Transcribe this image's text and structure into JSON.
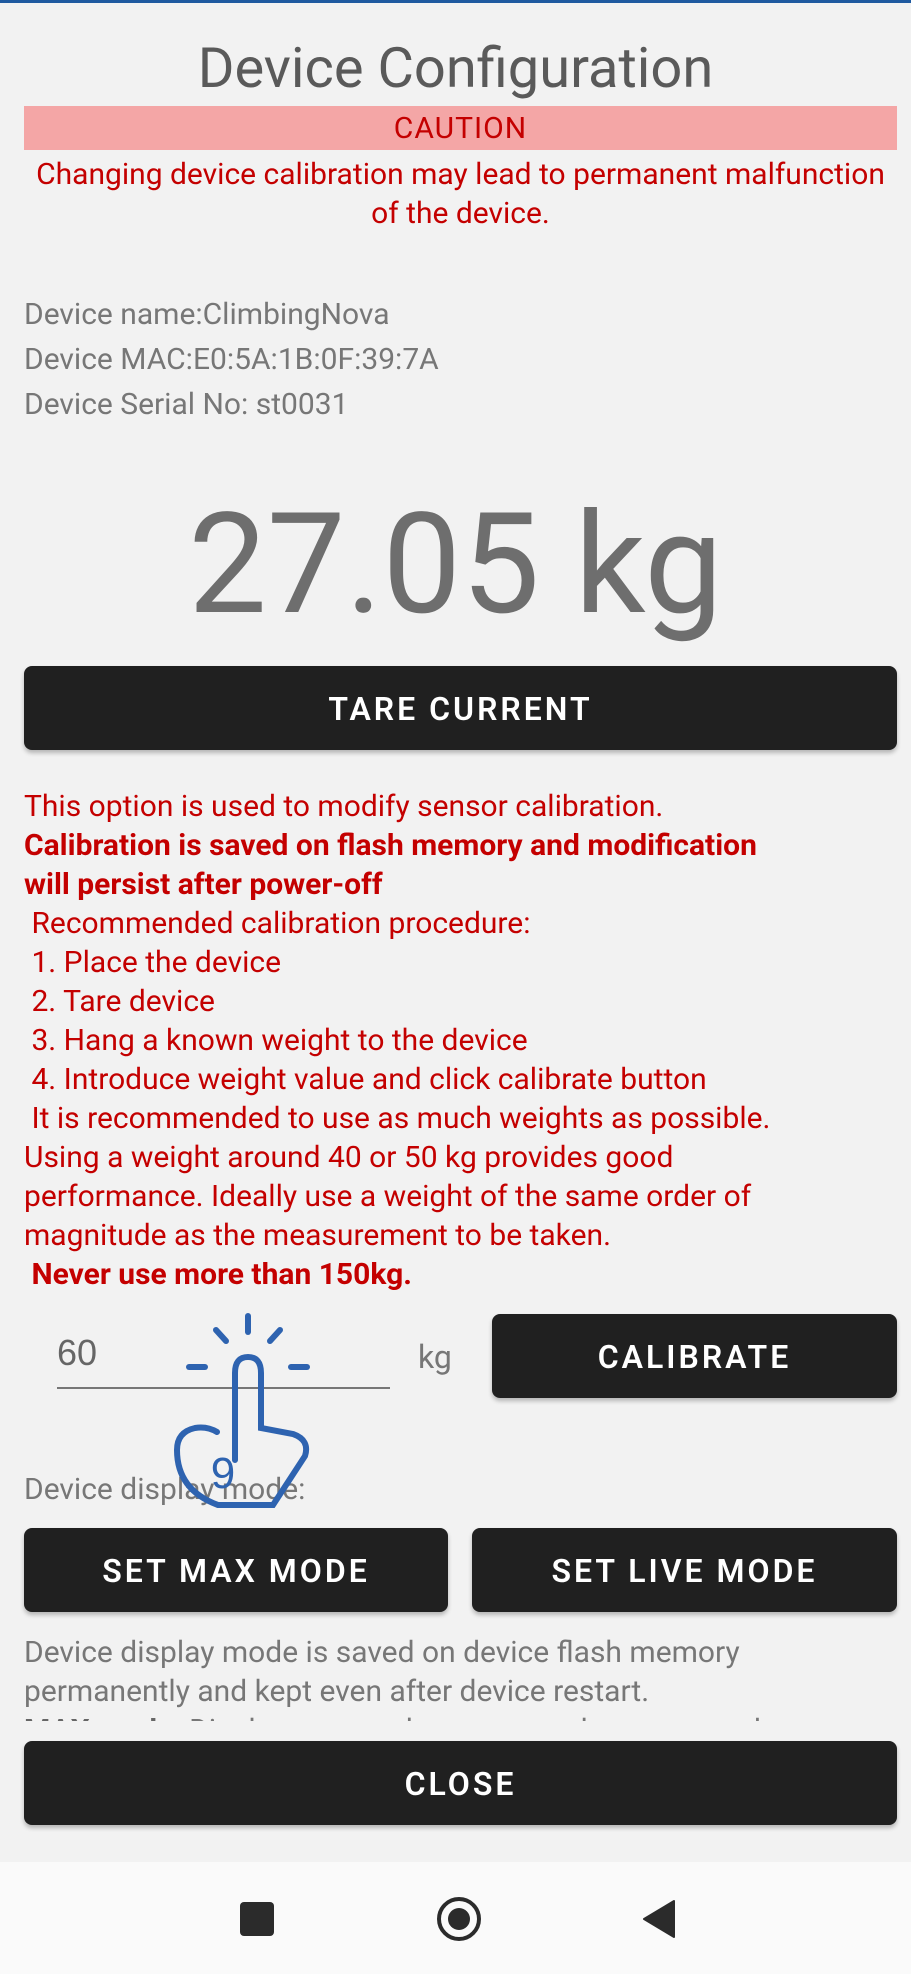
{
  "page": {
    "title": "Device Configuration",
    "caution_label": "CAUTION",
    "caution_text": "Changing device calibration may lead to permanent malfunction of the device."
  },
  "device": {
    "name_line": "Device name:ClimbingNova",
    "mac_line": "Device MAC:E0:5A:1B:0F:39:7A",
    "serial_line": "Device Serial No: st0031"
  },
  "reading": {
    "value": "27.05 kg"
  },
  "buttons": {
    "tare": "TARE CURRENT",
    "calibrate": "CALIBRATE",
    "set_max": "SET MAX MODE",
    "set_live": "SET LIVE MODE",
    "close": "CLOSE"
  },
  "calibration_help": {
    "intro": "This option is used to modify sensor calibration.",
    "persist_1": "Calibration is saved on flash memory and modification",
    "persist_2": "will persist after power-off",
    "recommended": " Recommended calibration procedure:",
    "step1": " 1. Place the device",
    "step2": " 2. Tare device",
    "step3": " 3. Hang a known weight to the device",
    "step4": " 4. Introduce weight value and click calibrate button",
    "note_1": " It is recommended to use as much weights as possible.",
    "note_2": "Using a weight around 40 or 50 kg provides good",
    "note_3": "performance. Ideally use a weight of the same order of",
    "note_4": "magnitude as the measurement to be taken.",
    "never": " Never use more than 150kg."
  },
  "calibration_input": {
    "value": "60",
    "unit": "kg"
  },
  "display_mode": {
    "label": "Device display mode:",
    "desc_1": "Device display mode is saved on device flash memory",
    "desc_2": "permanently and kept even after device restart.",
    "desc_3_bold": " MAX mode:",
    "desc_3_rest": " Display screen shows max value measured"
  },
  "colors": {
    "accent_red": "#c40000",
    "caution_bg": "#f4a6a6",
    "button_bg": "#202020",
    "touch_indicator": "#2e63b0"
  },
  "icons": {
    "nav_recents": "square-icon",
    "nav_home": "home-circle-icon",
    "nav_back": "back-triangle-icon",
    "touch": "tap-gesture-icon"
  }
}
